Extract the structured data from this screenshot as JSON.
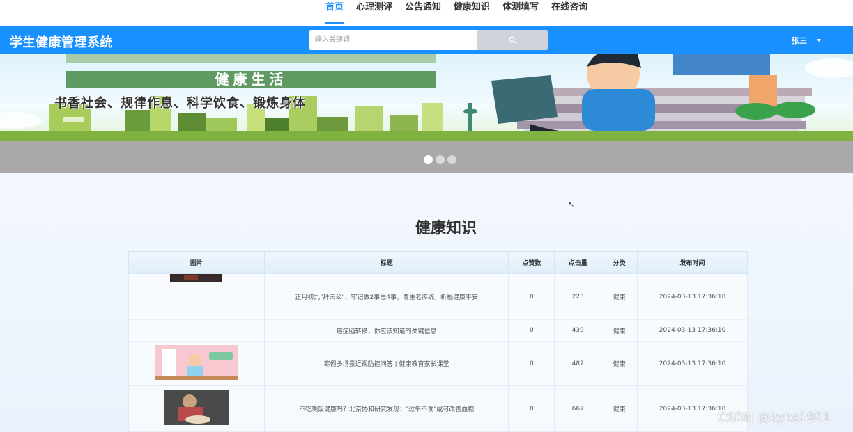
{
  "nav": {
    "items": [
      "首页",
      "心理测评",
      "公告通知",
      "健康知识",
      "体测填写",
      "在线咨询"
    ],
    "active_index": 0
  },
  "header": {
    "title": "学生健康管理系统",
    "search_placeholder": "输入关键词",
    "user_name": "张三"
  },
  "banner": {
    "subtitle": "健康生活",
    "slogan": "书香社会、规律作息、科学饮食、锻炼身体",
    "slide_count": 3,
    "active_slide": 0
  },
  "section": {
    "title": "健康知识"
  },
  "table": {
    "headers": [
      "图片",
      "标题",
      "点赞数",
      "点击量",
      "分类",
      "发布时间"
    ],
    "rows": [
      {
        "title": "正月初九\"拜天公\"，牢记做2事忌4事，尊重老传统，祈福健康平安",
        "likes": "0",
        "clicks": "223",
        "category": "健康",
        "time": "2024-03-13 17:36:10"
      },
      {
        "title": "癌症脑转移，你应该知道的关键信息",
        "likes": "0",
        "clicks": "439",
        "category": "健康",
        "time": "2024-03-13 17:36:10"
      },
      {
        "title": "寒假多场景近视防控问答 | 健康教育家长课堂",
        "likes": "0",
        "clicks": "482",
        "category": "健康",
        "time": "2024-03-13 17:36:10"
      },
      {
        "title": "不吃晚饭健康吗？北京协和研究发现：\"过午不食\"或可改善血糖",
        "likes": "0",
        "clicks": "667",
        "category": "健康",
        "time": "2024-03-13 17:36:10"
      }
    ]
  },
  "watermark": "CSDN @kybs1991",
  "colors": {
    "accent": "#1890ff",
    "nav_active": "#1e90ff",
    "banner_strip": "#a9a9a9"
  }
}
